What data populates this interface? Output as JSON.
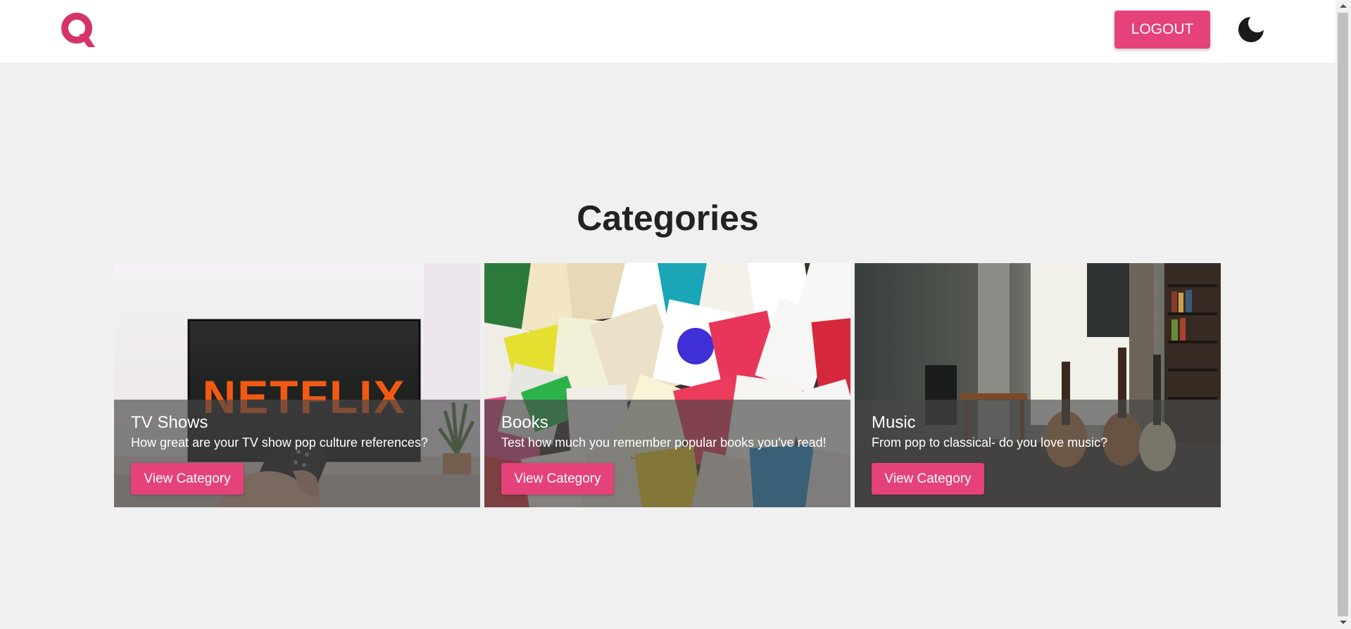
{
  "header": {
    "logo_icon": "q-logo-icon",
    "logout_label": "LOGOUT",
    "theme_icon": "moon-icon"
  },
  "main": {
    "title": "Categories",
    "categories": [
      {
        "title": "TV Shows",
        "description": "How great are your TV show pop culture references?",
        "button_label": "View Category",
        "image_icon": "tv-netflix-image",
        "image_text": "NETFLIX"
      },
      {
        "title": "Books",
        "description": "Test how much you remember popular books you've read!",
        "button_label": "View Category",
        "image_icon": "books-pile-image"
      },
      {
        "title": "Music",
        "description": "From pop to classical- do you love music?",
        "button_label": "View Category",
        "image_icon": "music-room-image"
      }
    ]
  },
  "colors": {
    "accent": "#e5417a",
    "background": "#f0f0f0",
    "navbar": "#ffffff",
    "title_text": "#222222"
  }
}
